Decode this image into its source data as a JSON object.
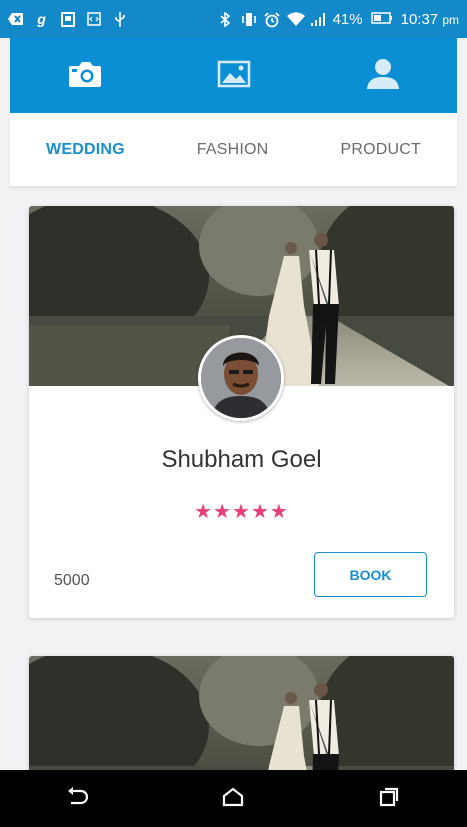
{
  "status_bar": {
    "battery_percent": "41%",
    "time": "10:37",
    "time_suffix": "pm",
    "icons": [
      "notification-icon",
      "g-icon",
      "sim-icon",
      "code-icon",
      "usb-icon",
      "bluetooth-icon",
      "vibrate-icon",
      "alarm-icon",
      "wifi-icon",
      "signal-icon",
      "battery-icon"
    ]
  },
  "top_nav": {
    "items": [
      {
        "name": "camera-icon",
        "active": true
      },
      {
        "name": "image-icon",
        "active": false
      },
      {
        "name": "person-icon",
        "active": false
      }
    ],
    "color": "#0b8fd4"
  },
  "tabs": [
    {
      "label": "WEDDING",
      "active": true
    },
    {
      "label": "FASHION",
      "active": false
    },
    {
      "label": "PRODUCT",
      "active": false
    }
  ],
  "cards": [
    {
      "name": "Shubham Goel",
      "rating": 5,
      "stars": "★★★★★",
      "price": "5000",
      "button_label": "BOOK"
    }
  ],
  "accent_color": "#1a8fd0",
  "star_color": "#e6407a",
  "android_nav": [
    "back-icon",
    "home-icon",
    "recents-icon"
  ]
}
